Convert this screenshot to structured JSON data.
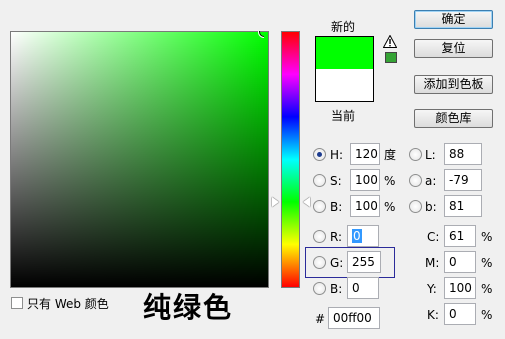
{
  "field": {
    "hue_deg": 120,
    "marker_saturation_pct": 100,
    "marker_brightness_pct": 100
  },
  "swatch": {
    "new_label": "新的",
    "current_label": "当前",
    "new_color": "#00ff00",
    "current_color": "#ffffff",
    "gamut_color": "#35a335"
  },
  "buttons": {
    "ok": "确定",
    "reset": "复位",
    "add_to_swatches": "添加到色板",
    "color_libraries": "颜色库"
  },
  "hsb": {
    "h": {
      "label": "H:",
      "value": "120",
      "unit": "度"
    },
    "s": {
      "label": "S:",
      "value": "100",
      "unit": "%"
    },
    "b": {
      "label": "B:",
      "value": "100",
      "unit": "%"
    }
  },
  "rgb": {
    "r": {
      "label": "R:",
      "value": "0"
    },
    "g": {
      "label": "G:",
      "value": "255"
    },
    "b": {
      "label": "B:",
      "value": "0"
    }
  },
  "lab": {
    "l": {
      "label": "L:",
      "value": "88"
    },
    "a": {
      "label": "a:",
      "value": "-79"
    },
    "b": {
      "label": "b:",
      "value": "81"
    }
  },
  "cmyk": {
    "c": {
      "label": "C:",
      "value": "61",
      "unit": "%"
    },
    "m": {
      "label": "M:",
      "value": "0",
      "unit": "%"
    },
    "y": {
      "label": "Y:",
      "value": "100",
      "unit": "%"
    },
    "k": {
      "label": "K:",
      "value": "0",
      "unit": "%"
    }
  },
  "hex": {
    "label": "#",
    "value": "00ff00"
  },
  "web_only": {
    "label": "只有 Web 颜色",
    "checked": false
  },
  "caption": "纯绿色",
  "icons": {
    "warning": "warning-triangle-icon"
  }
}
